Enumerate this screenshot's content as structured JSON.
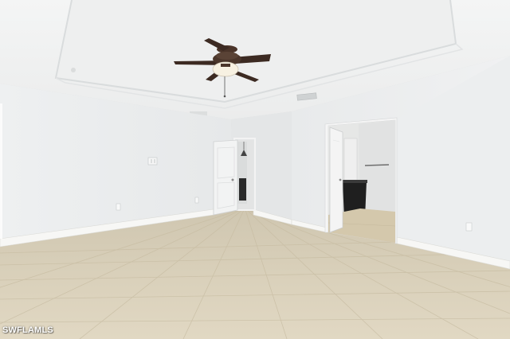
{
  "photo": {
    "subject": "empty-room",
    "watermark": "SWFLAMLS"
  },
  "colors": {
    "wall": "#eceeee",
    "ceiling": "#f1f2f2",
    "floor_tile": "#d9cfb6",
    "baseboard": "#f6f6f4",
    "fan_blade": "#3c2a22",
    "vanity": "#1f1f1f"
  }
}
